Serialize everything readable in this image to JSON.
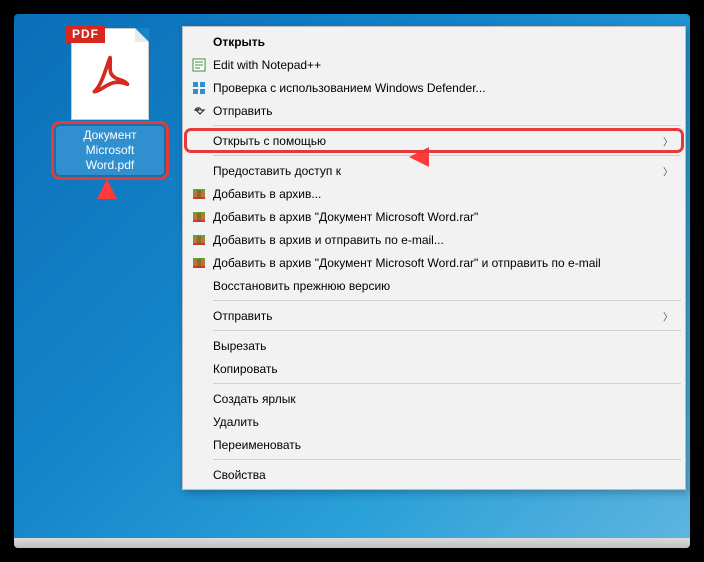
{
  "file": {
    "badge": "PDF",
    "label": "Документ Microsoft Word.pdf"
  },
  "menu": {
    "open": "Открыть",
    "edit_notepad": "Edit with Notepad++",
    "defender": "Проверка с использованием Windows Defender...",
    "send_share": "Отправить",
    "open_with": "Открыть с помощью",
    "give_access": "Предоставить доступ к",
    "add_archive": "Добавить в архив...",
    "add_archive_name": "Добавить в архив \"Документ Microsoft Word.rar\"",
    "add_send_email": "Добавить в архив и отправить по e-mail...",
    "add_name_email": "Добавить в архив \"Документ Microsoft Word.rar\" и отправить по e-mail",
    "restore": "Восстановить прежнюю версию",
    "send_to": "Отправить",
    "cut": "Вырезать",
    "copy": "Копировать",
    "shortcut": "Создать ярлык",
    "delete": "Удалить",
    "rename": "Переименовать",
    "properties": "Свойства"
  }
}
